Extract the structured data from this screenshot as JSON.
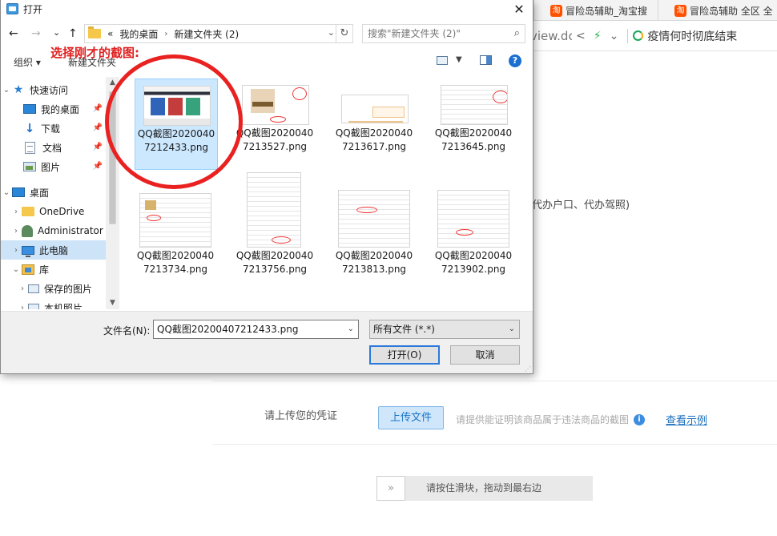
{
  "browser": {
    "tabs": [
      {
        "icon_text": "淘",
        "label": "冒险岛辅助_淘宝搜"
      },
      {
        "icon_text": "淘",
        "label": "冒险岛辅助 全区 全"
      }
    ],
    "url_fragment": "view.dc",
    "news_text": "疫情何时彻底结束",
    "side_text": "代办户口、代办驾照)",
    "upload_label": "请上传您的凭证",
    "upload_button": "上传文件",
    "upload_hint": "请提供能证明该商品属于违法商品的截图",
    "example_link": "查看示例",
    "slider_handle": "»",
    "slider_text": "请按住滑块，拖动到最右边"
  },
  "dialog": {
    "title": "打开",
    "close": "✕",
    "nav": {
      "back": "←",
      "forward": "→",
      "recent": "⌄",
      "up": "↑"
    },
    "breadcrumb": [
      "«",
      "我的桌面",
      "新建文件夹 (2)"
    ],
    "search_placeholder": "搜索\"新建文件夹 (2)\"",
    "organize_label": "组织 ▾",
    "new_folder_label": "新建文件夹",
    "annotation": "选择刚才的截图:",
    "sidebar": [
      {
        "label": "快速访问",
        "icon": "star-icon",
        "pinned": false
      },
      {
        "label": "我的桌面",
        "icon": "desktop-icon",
        "pinned": true
      },
      {
        "label": "下载",
        "icon": "download-icon",
        "pinned": true
      },
      {
        "label": "文档",
        "icon": "document-icon",
        "pinned": true
      },
      {
        "label": "图片",
        "icon": "picture-icon",
        "pinned": true
      },
      {
        "label": "桌面",
        "icon": "desktop-icon",
        "pinned": false
      },
      {
        "label": "OneDrive",
        "icon": "folder-icon",
        "pinned": false
      },
      {
        "label": "Administrator",
        "icon": "user-icon",
        "pinned": false
      },
      {
        "label": "此电脑",
        "icon": "computer-icon",
        "pinned": false,
        "selected": true
      },
      {
        "label": "库",
        "icon": "library-icon",
        "pinned": false
      },
      {
        "label": "保存的图片",
        "icon": "picture-icon",
        "pinned": false
      },
      {
        "label": "本机照片",
        "icon": "picture-icon",
        "pinned": false
      }
    ],
    "files": [
      {
        "name": "QQ截图20200407212433.png",
        "selected": true
      },
      {
        "name": "QQ截图20200407213527.png",
        "selected": false
      },
      {
        "name": "QQ截图20200407213617.png",
        "selected": false
      },
      {
        "name": "QQ截图20200407213645.png",
        "selected": false
      },
      {
        "name": "QQ截图20200407213734.png",
        "selected": false
      },
      {
        "name": "QQ截图20200407213756.png",
        "selected": false
      },
      {
        "name": "QQ截图20200407213813.png",
        "selected": false
      },
      {
        "name": "QQ截图20200407213902.png",
        "selected": false
      }
    ],
    "filename_label": "文件名(N):",
    "filename_value": "QQ截图20200407212433.png",
    "filter_value": "所有文件 (*.*)",
    "open_button": "打开(O)",
    "cancel_button": "取消"
  },
  "colors": {
    "annotation": "#e02020",
    "selection": "#cce8ff",
    "accent": "#2b79d9"
  }
}
